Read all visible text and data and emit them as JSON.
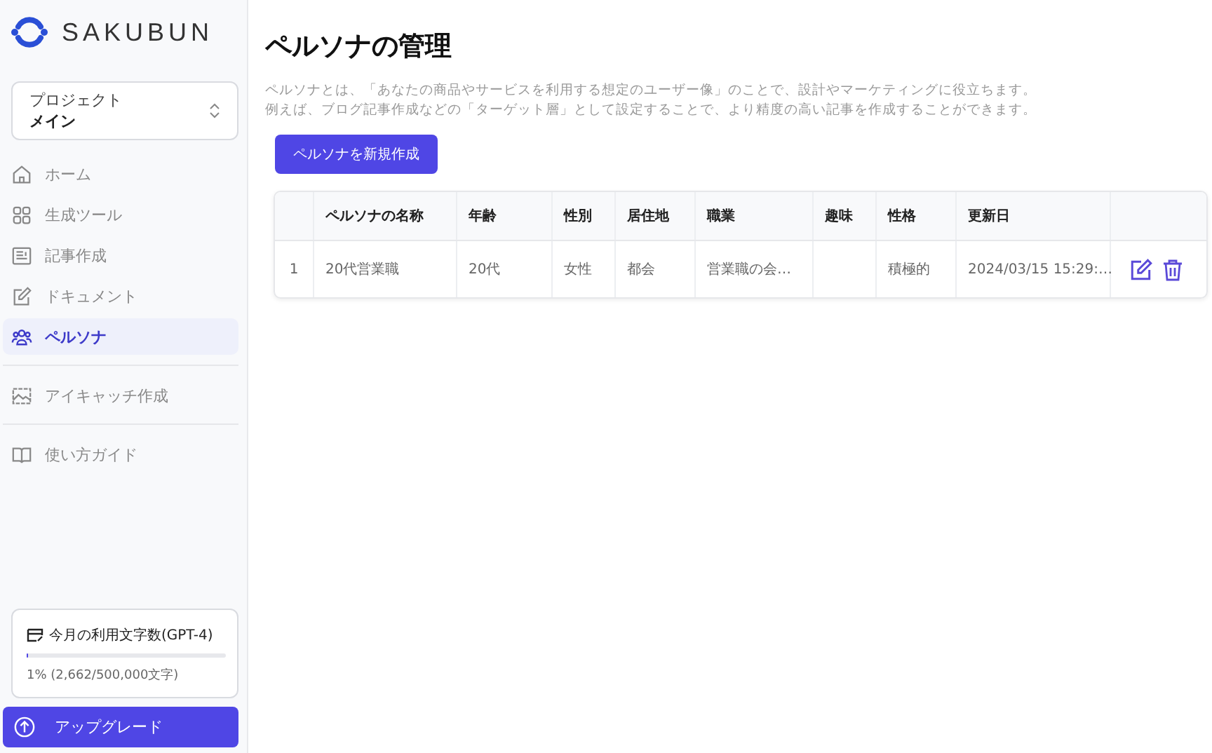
{
  "brand": {
    "name": "SAKUBUN"
  },
  "project": {
    "label": "プロジェクト",
    "value": "メイン"
  },
  "nav_groups": [
    [
      {
        "kind": "home",
        "label": "ホーム",
        "selected": false
      },
      {
        "kind": "grid",
        "label": "生成ツール",
        "selected": false
      },
      {
        "kind": "article",
        "label": "記事作成",
        "selected": false
      },
      {
        "kind": "pencil",
        "label": "ドキュメント",
        "selected": false
      },
      {
        "kind": "people",
        "label": "ペルソナ",
        "selected": true
      }
    ],
    [
      {
        "kind": "image",
        "label": "アイキャッチ作成",
        "selected": false
      }
    ],
    [
      {
        "kind": "book",
        "label": "使い方ガイド",
        "selected": false
      }
    ]
  ],
  "usage": {
    "title": "今月の利用文字数(GPT-4)",
    "level": 0.01,
    "reading": "1% (2,662/500,000文字)"
  },
  "upgrade": {
    "label": "アップグレード"
  },
  "page": {
    "title": "ペルソナの管理",
    "description": [
      "ペルソナとは、「あなたの商品やサービスを利用する想定のユーザー像」のことで、設計やマーケティングに役立ちます。",
      "例えば、ブログ記事作成などの「ターゲット層」として設定することで、より精度の高い記事を作成することができます。"
    ],
    "create_button": "ペルソナを新規作成"
  },
  "table": {
    "columns": [
      "ペルソナの名称",
      "年齢",
      "性別",
      "居住地",
      "職業",
      "趣味",
      "性格",
      "更新日"
    ],
    "rows": [
      {
        "index": "1",
        "cells": [
          "20代営業職",
          "20代",
          "女性",
          "都会",
          "営業職の会…",
          "",
          "積極的",
          "2024/03/15 15:29:…"
        ]
      }
    ]
  }
}
